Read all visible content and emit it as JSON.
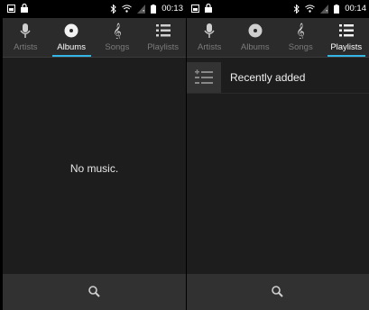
{
  "screens": [
    {
      "status": {
        "time": "00:13"
      },
      "tabs": [
        {
          "label": "Artists",
          "icon": "microphone-icon"
        },
        {
          "label": "Albums",
          "icon": "album-disc-icon",
          "active": true
        },
        {
          "label": "Songs",
          "icon": "treble-clef-icon"
        },
        {
          "label": "Playlists",
          "icon": "playlist-icon"
        }
      ],
      "empty_message": "No music.",
      "bottom_icon": "search-icon"
    },
    {
      "status": {
        "time": "00:14"
      },
      "tabs": [
        {
          "label": "Artists",
          "icon": "microphone-icon"
        },
        {
          "label": "Albums",
          "icon": "album-disc-icon"
        },
        {
          "label": "Songs",
          "icon": "treble-clef-icon"
        },
        {
          "label": "Playlists",
          "icon": "playlist-icon",
          "active": true
        }
      ],
      "playlists": [
        {
          "label": "Recently added",
          "icon": "add-playlist-icon"
        }
      ],
      "bottom_icon": "search-icon"
    }
  ],
  "colors": {
    "accent": "#33b5e5",
    "background": "#1d1d1d",
    "tabbar": "#2b2b2b",
    "bottombar": "#313131"
  }
}
